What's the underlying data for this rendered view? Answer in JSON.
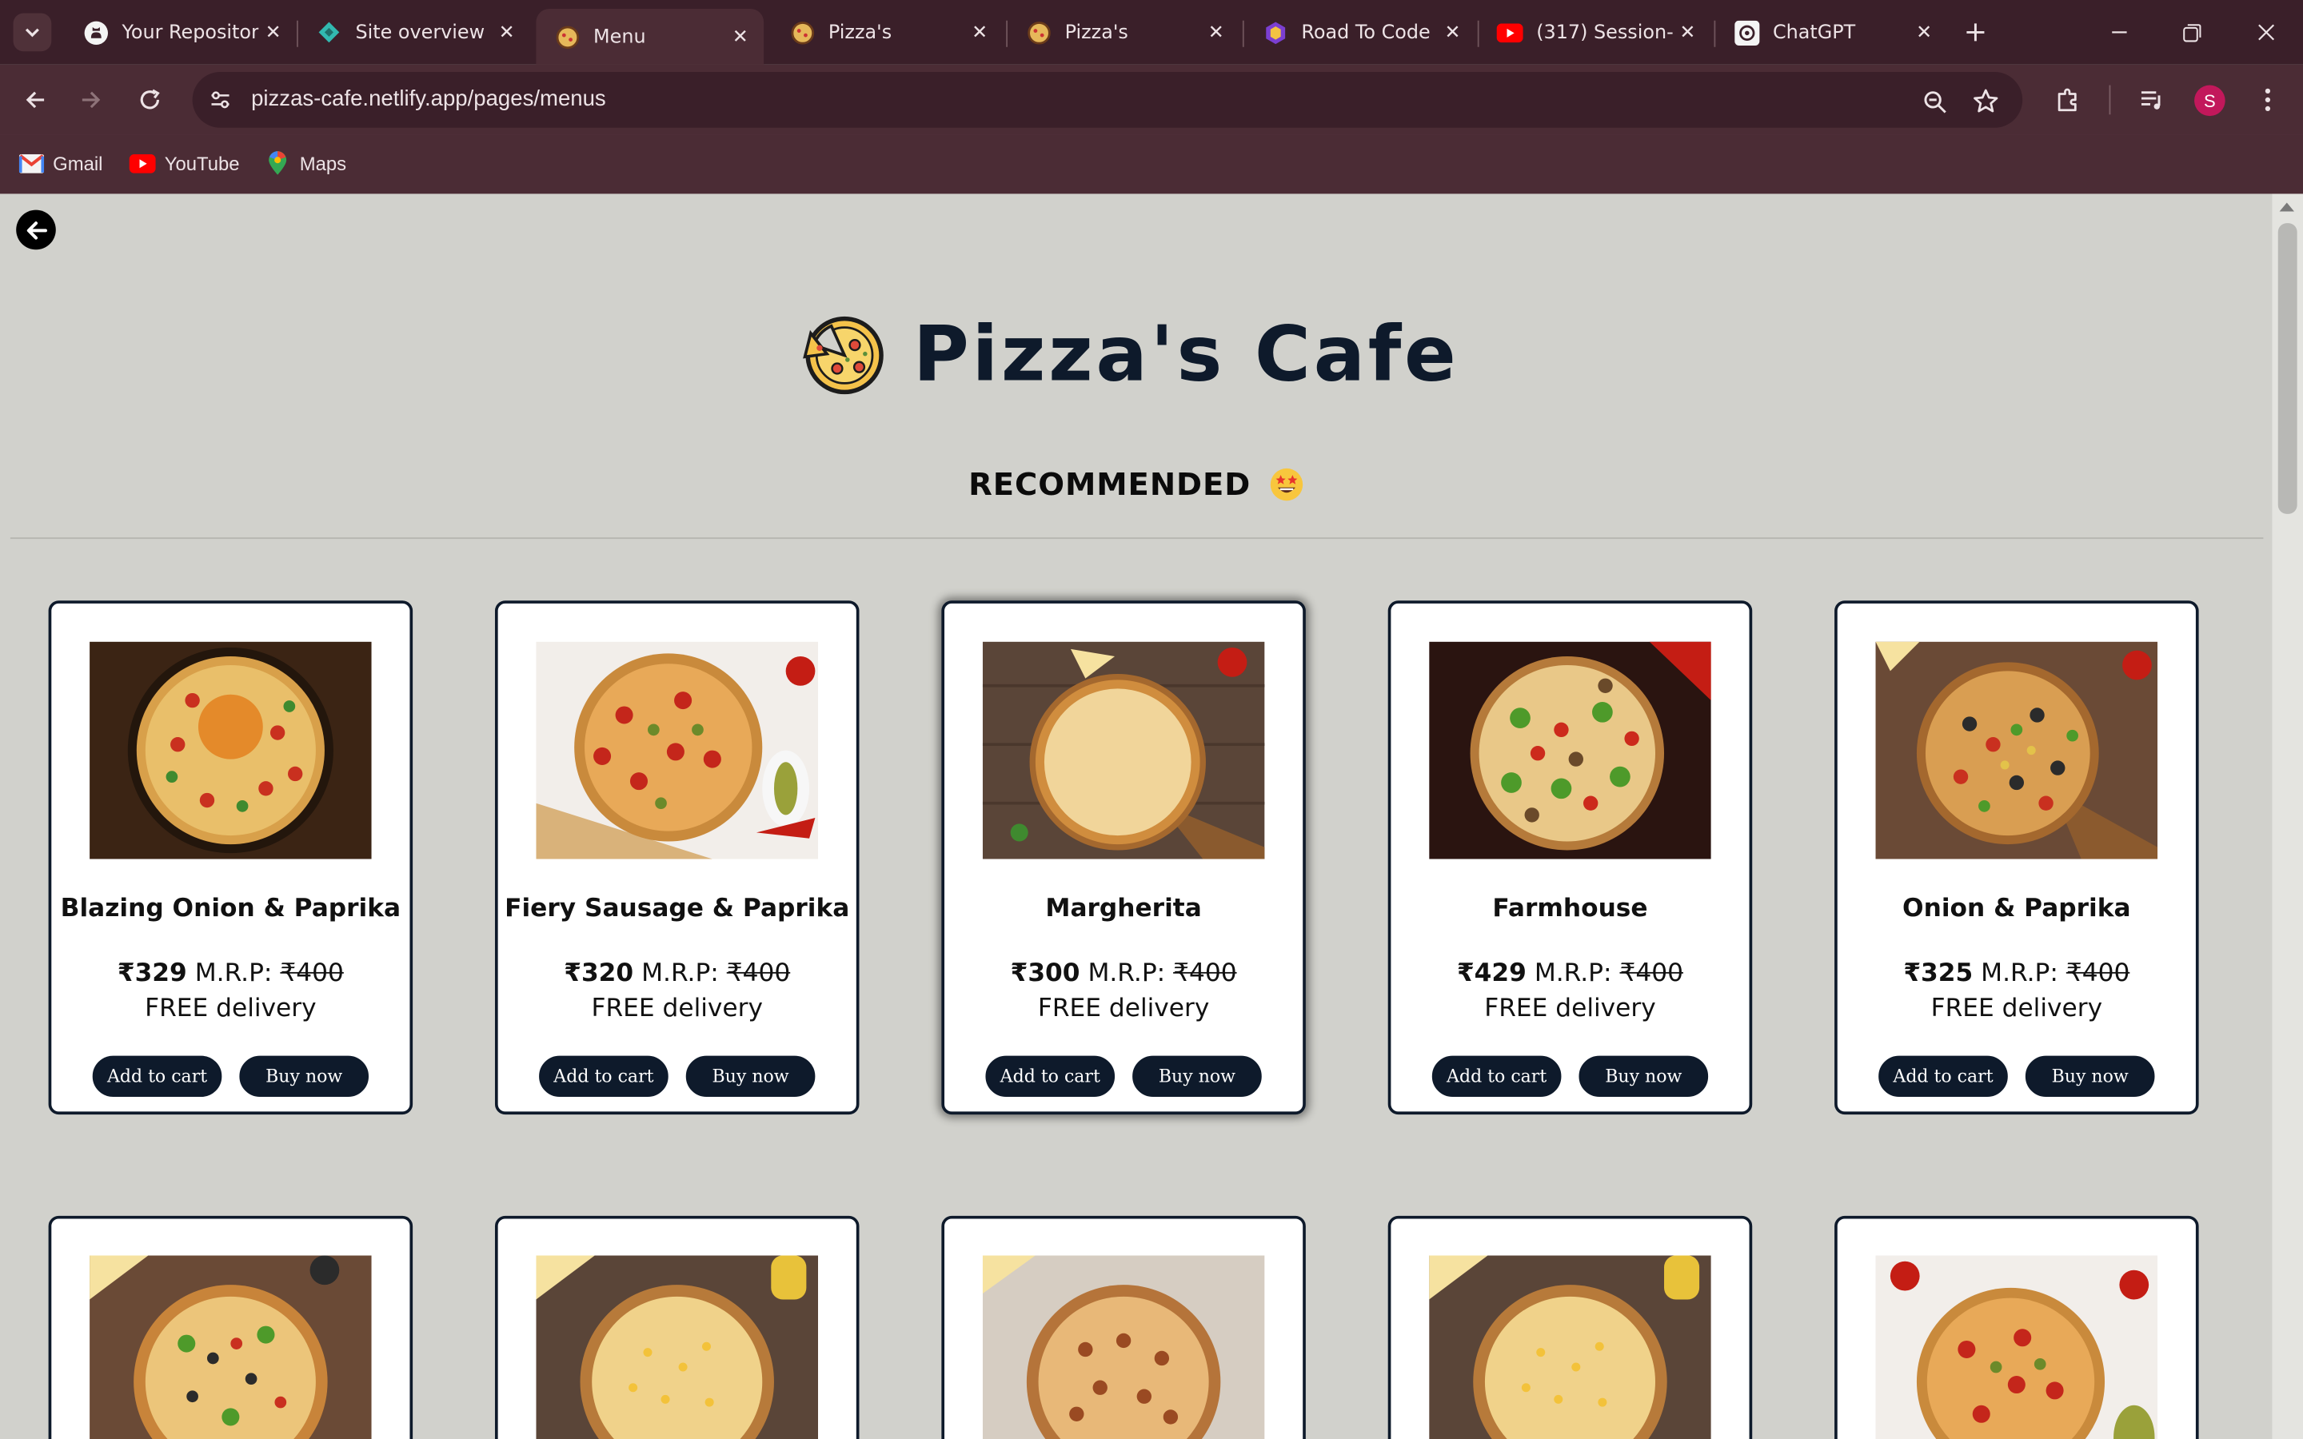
{
  "browser": {
    "tabs": [
      {
        "title": "Your Repositor",
        "icon": "github-icon",
        "active": false
      },
      {
        "title": "Site overview |",
        "icon": "netlify-icon",
        "active": false
      },
      {
        "title": "Menu",
        "icon": "pizza-icon",
        "active": true
      },
      {
        "title": "Pizza's",
        "icon": "pizza-icon",
        "active": false
      },
      {
        "title": "Pizza's",
        "icon": "pizza-icon",
        "active": false
      },
      {
        "title": "Road To Code",
        "icon": "roadtocode-icon",
        "active": false
      },
      {
        "title": "(317) Session-",
        "icon": "youtube-icon",
        "active": false
      },
      {
        "title": "ChatGPT",
        "icon": "chatgpt-icon",
        "active": false
      }
    ],
    "url": "pizzas-cafe.netlify.app/pages/menus",
    "profile_initial": "S",
    "bookmarks": [
      {
        "label": "Gmail",
        "icon": "gmail-icon"
      },
      {
        "label": "YouTube",
        "icon": "youtube-icon"
      },
      {
        "label": "Maps",
        "icon": "maps-icon"
      }
    ],
    "colors": {
      "frame": "#3a1f29",
      "toolbar": "#4b2c35",
      "text": "#ede3e6"
    }
  },
  "page": {
    "brand_title": "Pizza's Cafe",
    "section_title": "RECOMMENDED",
    "colors": {
      "background": "#d1d1cc",
      "navy": "#0e1a2b",
      "card": "#ffffff"
    },
    "cards": [
      {
        "name": "Blazing Onion & Paprika",
        "price": "₹329",
        "mrp_label": "M.R.P:",
        "mrp": "₹400",
        "delivery": "FREE delivery",
        "cart_label": "Add to cart",
        "buy_label": "Buy now"
      },
      {
        "name": "Fiery Sausage & Paprika",
        "price": "₹320",
        "mrp_label": "M.R.P:",
        "mrp": "₹400",
        "delivery": "FREE delivery",
        "cart_label": "Add to cart",
        "buy_label": "Buy now"
      },
      {
        "name": "Margherita",
        "price": "₹300",
        "mrp_label": "M.R.P:",
        "mrp": "₹400",
        "delivery": "FREE delivery",
        "cart_label": "Add to cart",
        "buy_label": "Buy now"
      },
      {
        "name": "Farmhouse",
        "price": "₹429",
        "mrp_label": "M.R.P:",
        "mrp": "₹400",
        "delivery": "FREE delivery",
        "cart_label": "Add to cart",
        "buy_label": "Buy now"
      },
      {
        "name": "Onion & Paprika",
        "price": "₹325",
        "mrp_label": "M.R.P:",
        "mrp": "₹400",
        "delivery": "FREE delivery",
        "cart_label": "Add to cart",
        "buy_label": "Buy now"
      }
    ]
  }
}
